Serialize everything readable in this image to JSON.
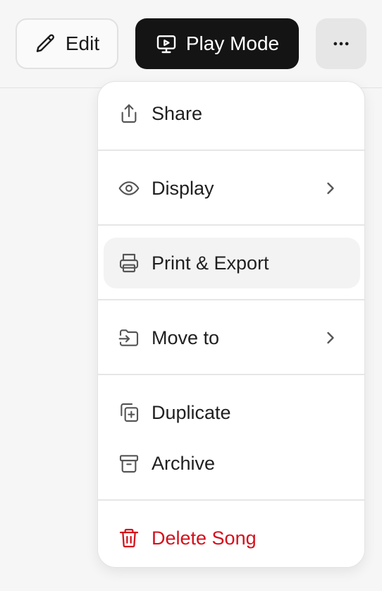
{
  "toolbar": {
    "edit_label": "Edit",
    "play_label": "Play Mode",
    "edit_icon": "pencil-icon",
    "play_icon": "presentation-play-icon",
    "more_icon": "more-horizontal-icon"
  },
  "menu": {
    "share": {
      "label": "Share",
      "icon": "share-upload-icon"
    },
    "display": {
      "label": "Display",
      "icon": "eye-icon",
      "submenu": true
    },
    "print_export": {
      "label": "Print & Export",
      "icon": "printer-icon",
      "highlighted": true
    },
    "move_to": {
      "label": "Move to",
      "icon": "move-folder-icon",
      "submenu": true
    },
    "duplicate": {
      "label": "Duplicate",
      "icon": "duplicate-icon"
    },
    "archive": {
      "label": "Archive",
      "icon": "archive-icon"
    },
    "delete_song": {
      "label": "Delete Song",
      "icon": "trash-icon",
      "danger": true
    }
  },
  "colors": {
    "primary_button_bg": "#141414",
    "danger": "#d4101c",
    "highlight_bg": "#f3f3f3",
    "page_bg": "#f6f6f6"
  }
}
